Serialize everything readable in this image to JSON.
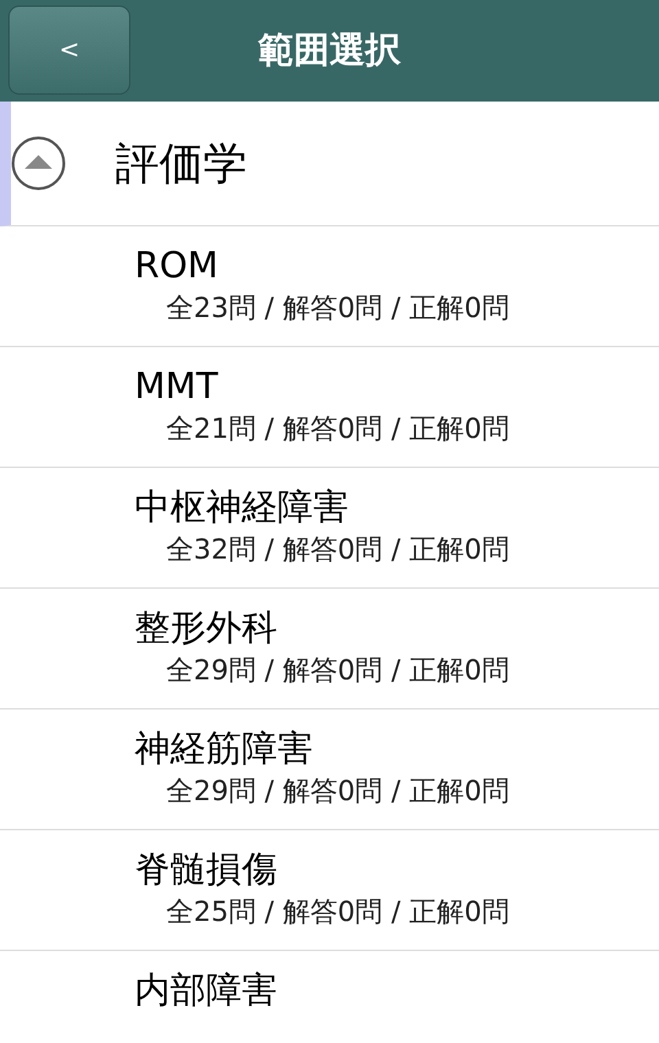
{
  "header": {
    "back_button": "<",
    "title": "範囲選択"
  },
  "category": {
    "title": "評価学",
    "expanded": true,
    "items": [
      {
        "title": "ROM",
        "stats": "全23問 / 解答0問 / 正解0問"
      },
      {
        "title": "MMT",
        "stats": "全21問 / 解答0問 / 正解0問"
      },
      {
        "title": "中枢神経障害",
        "stats": "全32問 / 解答0問 / 正解0問"
      },
      {
        "title": "整形外科",
        "stats": "全29問 / 解答0問 / 正解0問"
      },
      {
        "title": "神経筋障害",
        "stats": "全29問 / 解答0問 / 正解0問"
      },
      {
        "title": "脊髄損傷",
        "stats": "全25問 / 解答0問 / 正解0問"
      },
      {
        "title": "内部障害"
      }
    ]
  }
}
